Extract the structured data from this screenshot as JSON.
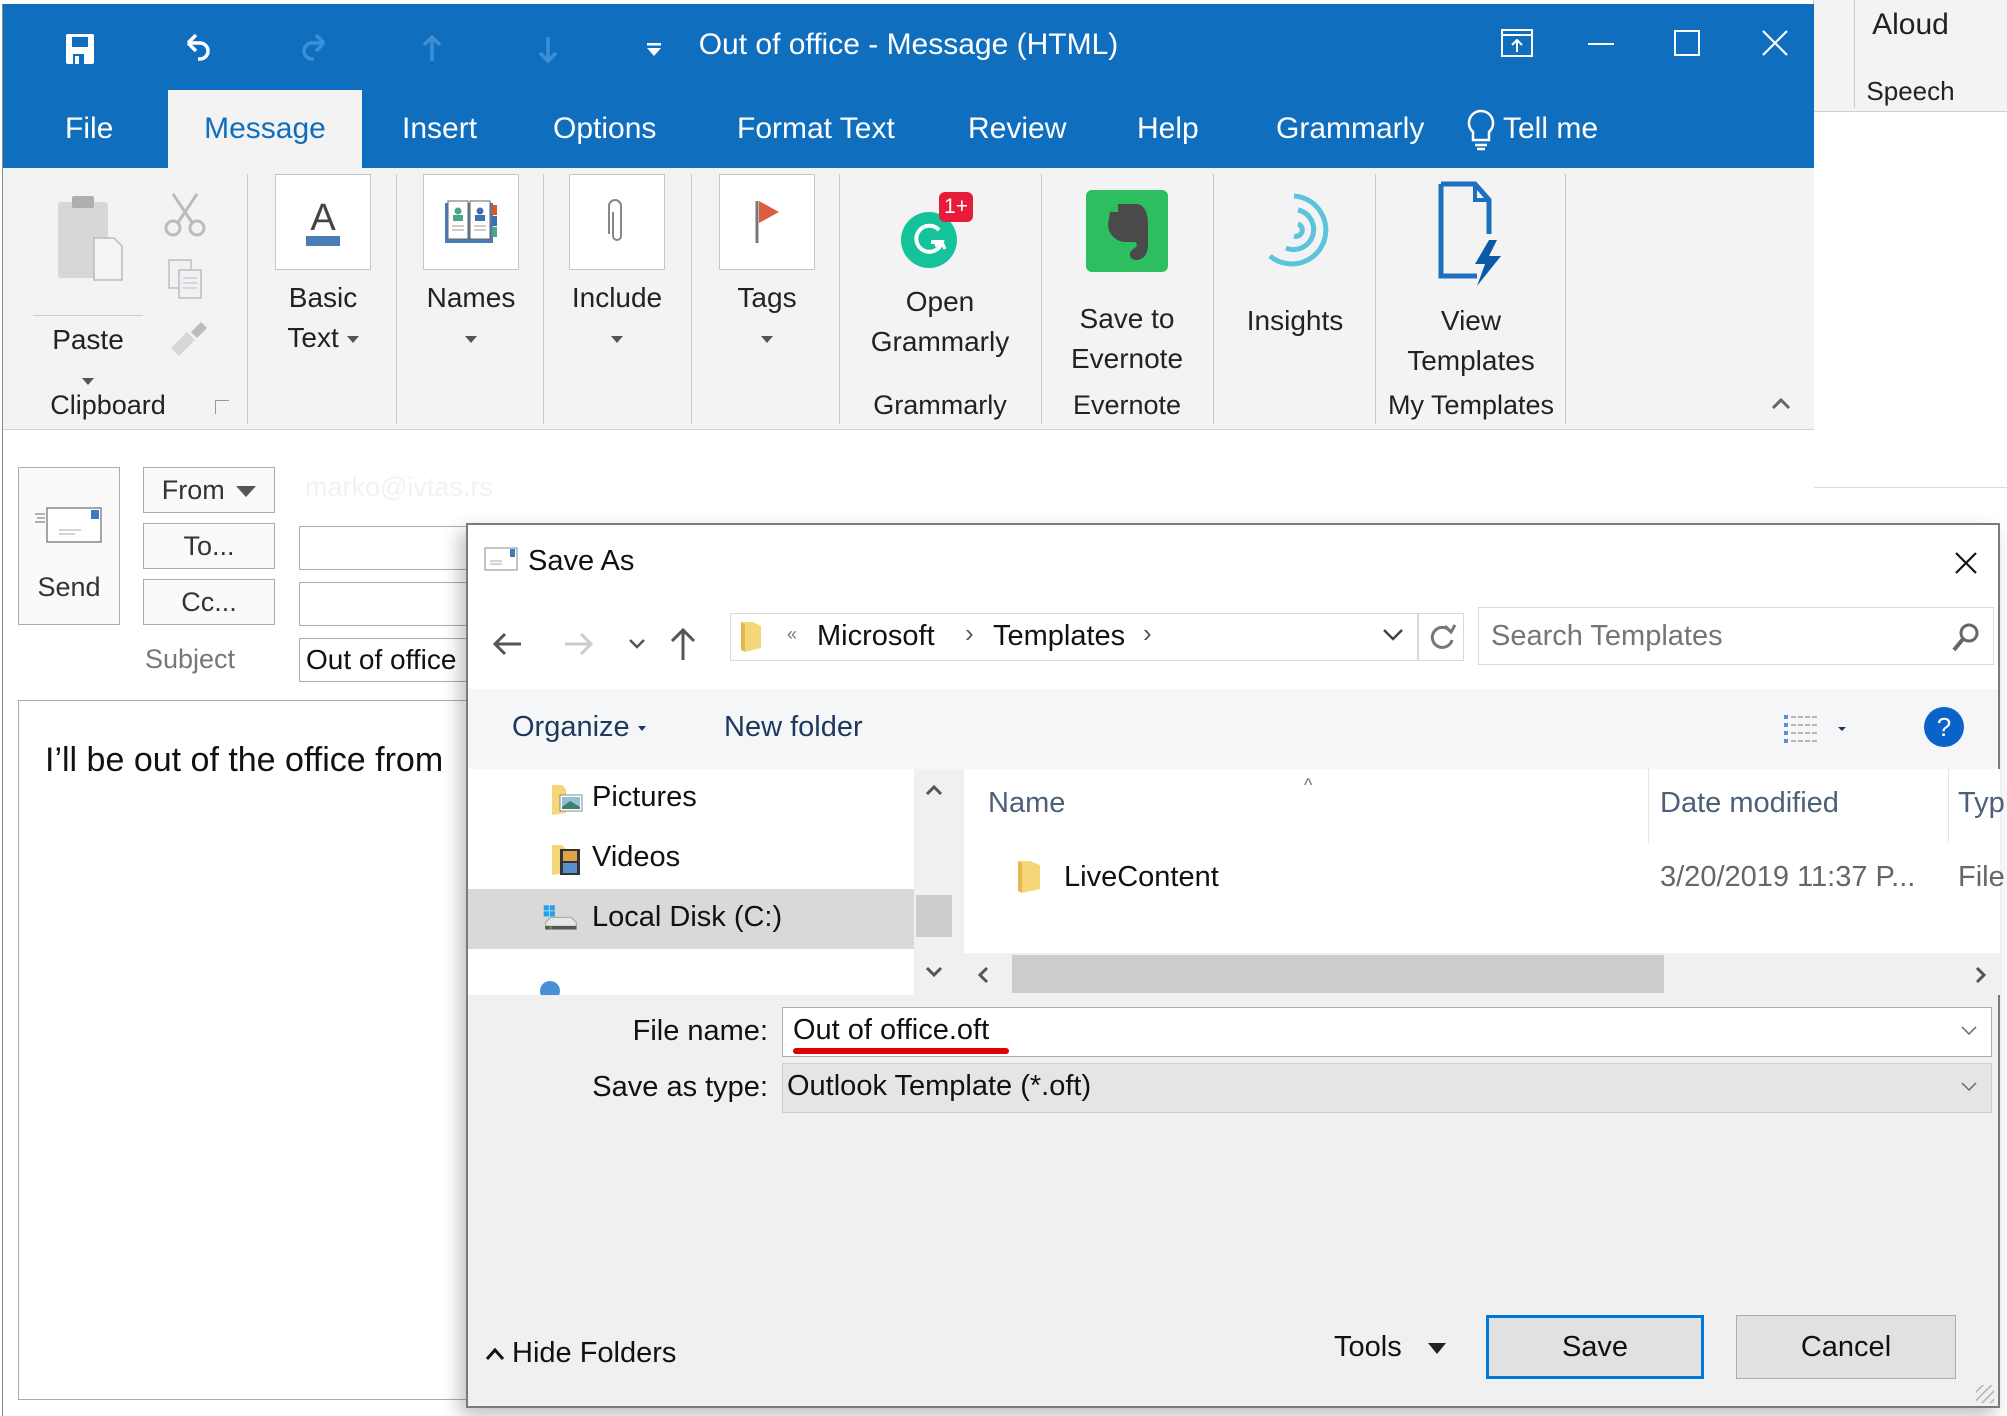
{
  "background_app": {
    "aloud_label": "Aloud",
    "speech_group_label": "Speech"
  },
  "window": {
    "title": "Out of office  -  Message (HTML)",
    "quick_access": [
      "save-icon",
      "undo-icon",
      "redo-icon",
      "previous-item-icon",
      "next-item-icon",
      "customize-qat-icon"
    ],
    "controls": [
      "ribbon-display-options-icon",
      "minimize-icon",
      "maximize-icon",
      "close-icon"
    ]
  },
  "tabs": [
    {
      "label": "File"
    },
    {
      "label": "Message",
      "active": true
    },
    {
      "label": "Insert"
    },
    {
      "label": "Options"
    },
    {
      "label": "Format Text"
    },
    {
      "label": "Review"
    },
    {
      "label": "Help"
    },
    {
      "label": "Grammarly"
    },
    {
      "label": "Tell me"
    }
  ],
  "ribbon": {
    "clipboard": {
      "paste": "Paste",
      "group": "Clipboard"
    },
    "basic_text": {
      "line1": "Basic",
      "line2": "Text"
    },
    "names": "Names",
    "include": "Include",
    "tags": "Tags",
    "grammarly": {
      "line1": "Open",
      "line2": "Grammarly",
      "badge": "1+",
      "group": "Grammarly"
    },
    "evernote": {
      "line1": "Save to",
      "line2": "Evernote",
      "group": "Evernote"
    },
    "insights": "Insights",
    "templates": {
      "line1": "View",
      "line2": "Templates",
      "group": "My Templates"
    },
    "colors": {
      "accent": "#106ebe",
      "grammarly": "#15c39a",
      "evernote": "#2dbe60",
      "badge": "#e81c3a",
      "insights": "#5bc4dc"
    }
  },
  "compose": {
    "send": "Send",
    "from": "From",
    "from_value": "marko@ivtas.rs",
    "to": "To...",
    "cc": "Cc...",
    "subject_label": "Subject",
    "subject_value": "Out of office",
    "body": "I’ll be out of the office from"
  },
  "dialog": {
    "title": "Save As",
    "breadcrumb": {
      "overflow": "«",
      "items": [
        "Microsoft",
        "Templates"
      ]
    },
    "search_placeholder": "Search Templates",
    "organize": "Organize",
    "new_folder": "New folder",
    "help": "?",
    "tree": [
      {
        "label": "Pictures",
        "icon": "pictures-folder-icon"
      },
      {
        "label": "Videos",
        "icon": "videos-folder-icon"
      },
      {
        "label": "Local Disk (C:)",
        "icon": "local-disk-icon",
        "selected": true
      }
    ],
    "columns": [
      "Name",
      "Date modified",
      "Typ"
    ],
    "files": [
      {
        "name": "LiveContent",
        "date": "3/20/2019 11:37 P...",
        "type": "File"
      }
    ],
    "file_name_label": "File name:",
    "file_name_value": "Out of office.oft",
    "save_type_label": "Save as type:",
    "save_type_value": "Outlook Template (*.oft)",
    "hide_folders": "Hide Folders",
    "tools": "Tools",
    "save": "Save",
    "cancel": "Cancel",
    "annotation_color": "#e00000"
  }
}
